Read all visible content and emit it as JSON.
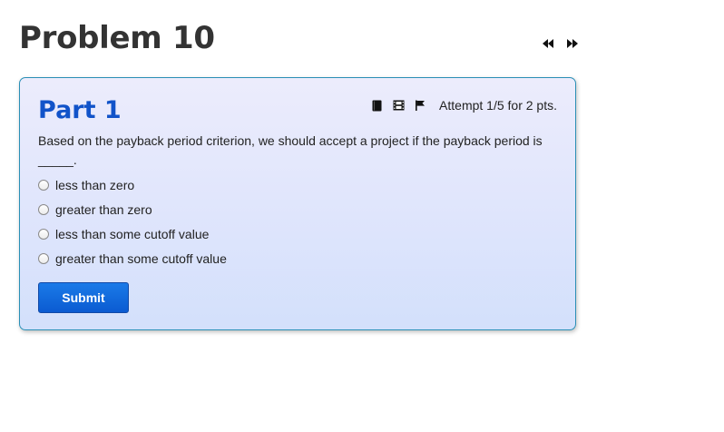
{
  "problem": {
    "title": "Problem 10"
  },
  "nav": {
    "prev_icon": "double-left-arrow",
    "next_icon": "double-right-arrow"
  },
  "part": {
    "title": "Part 1",
    "tools": [
      {
        "name": "book-icon"
      },
      {
        "name": "film-icon"
      },
      {
        "name": "flag-icon"
      }
    ],
    "attempt": "Attempt 1/5 for 2 pts.",
    "question": "Based on the payback period criterion, we should accept a project if the payback period is _____.",
    "options": [
      {
        "label": "less than zero",
        "selected": false
      },
      {
        "label": "greater than zero",
        "selected": false
      },
      {
        "label": "less than some cutoff value",
        "selected": false
      },
      {
        "label": "greater than some cutoff value",
        "selected": false
      }
    ],
    "submit_label": "Submit"
  },
  "colors": {
    "part_title": "#1153c9",
    "card_border": "#2a8fb6",
    "submit_bg": "#0b5bd1"
  }
}
